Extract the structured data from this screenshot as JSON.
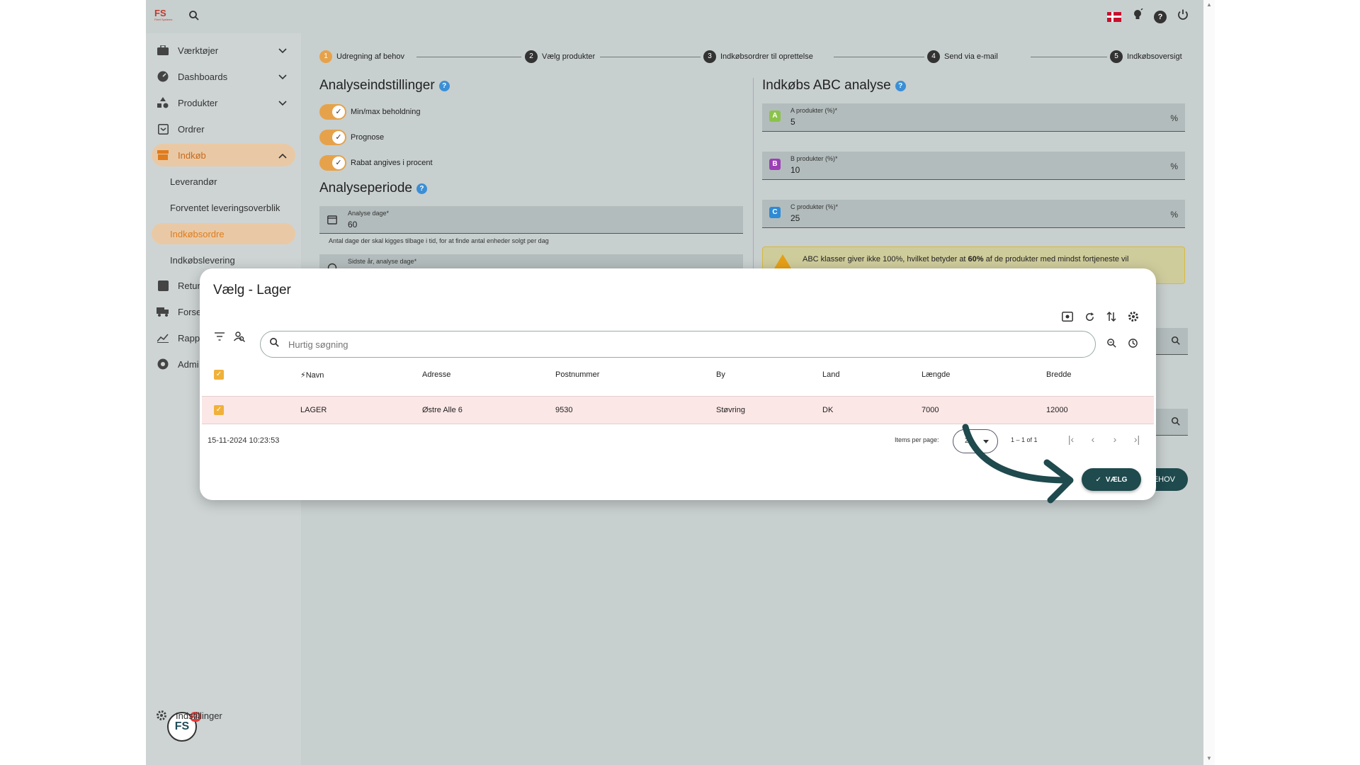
{
  "topbar": {
    "logo_text": "FS",
    "logo_sub": "Fleet Systems"
  },
  "sidebar": {
    "items": [
      {
        "label": "Værktøjer",
        "icon": "briefcase-icon",
        "chevron": "chevron-down"
      },
      {
        "label": "Dashboards",
        "icon": "dashboard-icon",
        "chevron": "chevron-down"
      },
      {
        "label": "Produkter",
        "icon": "shapes-icon",
        "chevron": "chevron-down"
      },
      {
        "label": "Ordrer",
        "icon": "inbox-icon"
      },
      {
        "label": "Indkøb",
        "icon": "shop-icon",
        "chevron": "chevron-up",
        "active": true
      },
      {
        "label": "Retur",
        "icon": "return-icon"
      },
      {
        "label": "Forse",
        "icon": "truck-icon"
      },
      {
        "label": "Rapp",
        "icon": "chart-icon"
      },
      {
        "label": "Admi",
        "icon": "admin-icon"
      }
    ],
    "subitems": [
      {
        "label": "Leverandør"
      },
      {
        "label": "Forventet leveringsoverblik"
      },
      {
        "label": "Indkøbsordre",
        "active": true
      },
      {
        "label": "Indkøbslevering"
      }
    ],
    "settings_label": "Indstillinger",
    "avatar_text": "FS",
    "badge_count": "22"
  },
  "stepper": {
    "steps": [
      {
        "num": "1",
        "label": "Udregning af behov"
      },
      {
        "num": "2",
        "label": "Vælg produkter"
      },
      {
        "num": "3",
        "label": "Indkøbsordrer til oprettelse"
      },
      {
        "num": "4",
        "label": "Send via e-mail"
      },
      {
        "num": "5",
        "label": "Indkøbsoversigt"
      }
    ]
  },
  "analysis": {
    "title": "Analyseindstillinger",
    "toggles": [
      {
        "label": "Min/max beholdning",
        "on": true
      },
      {
        "label": "Prognose",
        "on": true
      },
      {
        "label": "Rabat angives i procent",
        "on": true
      }
    ],
    "period_title": "Analyseperiode",
    "days_label": "Analyse dage*",
    "days_value": "60",
    "days_hint": "Antal dage der skal kigges tilbage i tid, for at finde antal enheder solgt per dag",
    "last_year_label": "Sidste år, analyse dage*"
  },
  "abc": {
    "title": "Indkøbs ABC analyse",
    "fields": [
      {
        "letter": "A",
        "label": "A produkter (%)*",
        "value": "5",
        "color": "#8bc34a"
      },
      {
        "letter": "B",
        "label": "B produkter (%)*",
        "value": "10",
        "color": "#9c3fb5"
      },
      {
        "letter": "C",
        "label": "C produkter (%)*",
        "value": "25",
        "color": "#2e8bd6"
      }
    ],
    "unit": "%",
    "warning_pre": "ABC klasser giver ikke 100%, hvilket betyder at ",
    "warning_bold": "60%",
    "warning_post": " af de produkter med mindst fortjeneste vil",
    "bg_button": "EHOV"
  },
  "dialog": {
    "title": "Vælg - Lager",
    "search_placeholder": "Hurtig søgning",
    "columns": [
      "Navn",
      "Adresse",
      "Postnummer",
      "By",
      "Land",
      "Længde",
      "Bredde"
    ],
    "rows": [
      {
        "name": "LAGER",
        "address": "Østre Alle 6",
        "zip": "9530",
        "city": "Støvring",
        "country": "DK",
        "length": "7000",
        "width": "12000",
        "selected": true
      }
    ],
    "timestamp": "15-11-2024 10:23:53",
    "items_per_page_label": "Items per page:",
    "items_per_page_value": "25",
    "range_label": "1 – 1 of 1",
    "choose_label": "VÆLG"
  },
  "colors": {
    "accent": "#e6a24a",
    "primary_dark": "#1f4a4e",
    "selected_row": "#fbe7e6"
  }
}
